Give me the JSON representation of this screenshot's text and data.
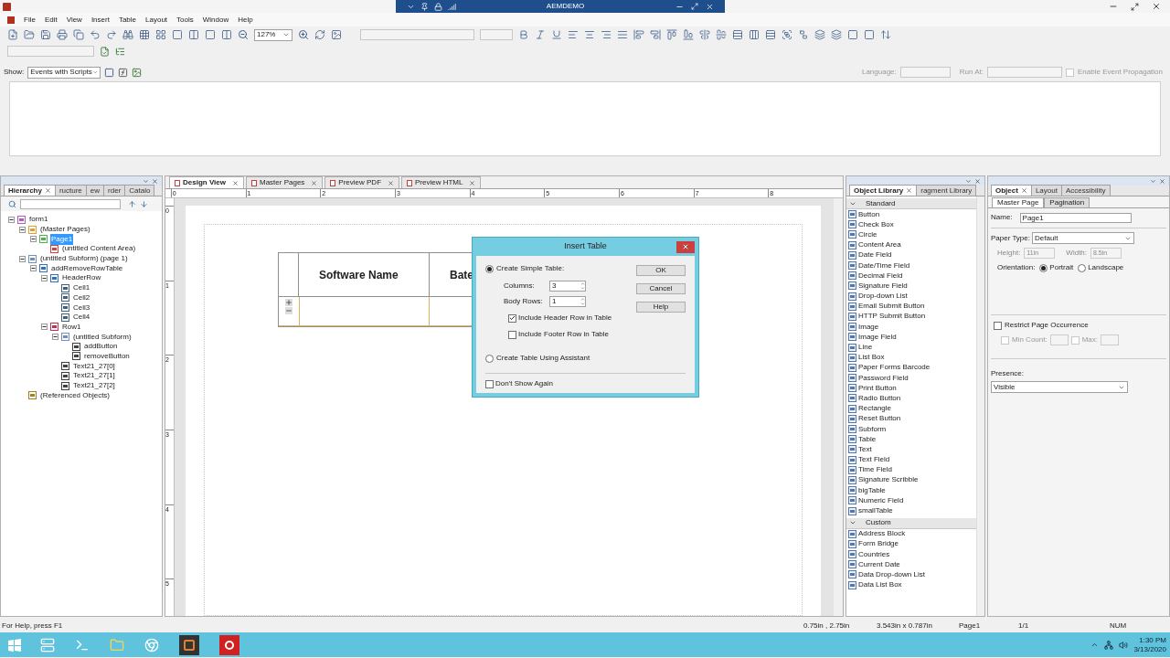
{
  "window": {
    "title": "AEMDEMO"
  },
  "menu": [
    "File",
    "Edit",
    "View",
    "Insert",
    "Table",
    "Layout",
    "Tools",
    "Window",
    "Help"
  ],
  "toolbar": {
    "zoom": "127%"
  },
  "script_bar": {
    "show_label": "Show:",
    "show_value": "Events with Scripts",
    "language_label": "Language:",
    "run_at_label": "Run At:",
    "propagation": {
      "label": "Enable Event Propagation",
      "checked": false
    }
  },
  "hierarchy": {
    "tabs": [
      {
        "label": "Hierarchy",
        "selected": true
      },
      {
        "label": "ructure",
        "selected": false
      },
      {
        "label": "ew",
        "selected": false
      },
      {
        "label": "rder",
        "selected": false
      },
      {
        "label": "Catalo",
        "selected": false
      }
    ],
    "tree": [
      {
        "label": "form1",
        "kind": "form",
        "selected": false,
        "expanded": true,
        "children": [
          {
            "label": "(Master Pages)",
            "kind": "pages",
            "selected": false,
            "expanded": true,
            "children": [
              {
                "label": "Page1",
                "kind": "page",
                "selected": true,
                "expanded": true,
                "children": [
                  {
                    "label": "(untitled Content Area)",
                    "kind": "area",
                    "selected": false
                  }
                ]
              }
            ]
          },
          {
            "label": "(untitled Subform) (page 1)",
            "kind": "subform",
            "selected": false,
            "expanded": true,
            "children": [
              {
                "label": "addRemoveRowTable",
                "kind": "table",
                "selected": false,
                "expanded": true,
                "children": [
                  {
                    "label": "HeaderRow",
                    "kind": "table",
                    "selected": false,
                    "expanded": true,
                    "children": [
                      {
                        "label": "Cell1",
                        "kind": "text",
                        "selected": false
                      },
                      {
                        "label": "Cell2",
                        "kind": "text",
                        "selected": false
                      },
                      {
                        "label": "Cell3",
                        "kind": "text",
                        "selected": false
                      },
                      {
                        "label": "Cell4",
                        "kind": "text",
                        "selected": false
                      }
                    ]
                  },
                  {
                    "label": "Row1",
                    "kind": "row",
                    "selected": false,
                    "expanded": true,
                    "children": [
                      {
                        "label": "(untitled Subform)",
                        "kind": "subform",
                        "selected": false,
                        "expanded": true,
                        "children": [
                          {
                            "label": "addButton",
                            "kind": "button",
                            "selected": false
                          },
                          {
                            "label": "removeButton",
                            "kind": "button",
                            "selected": false
                          }
                        ]
                      },
                      {
                        "label": "Text21_27[0]",
                        "kind": "field",
                        "selected": false
                      },
                      {
                        "label": "Text21_27[1]",
                        "kind": "field",
                        "selected": false
                      },
                      {
                        "label": "Text21_27[2]",
                        "kind": "field",
                        "selected": false
                      }
                    ]
                  }
                ]
              }
            ]
          },
          {
            "label": "(Referenced Objects)",
            "kind": "refs",
            "selected": false
          }
        ]
      }
    ]
  },
  "design": {
    "tabs": [
      {
        "label": "Design View",
        "selected": true
      },
      {
        "label": "Master Pages",
        "selected": false
      },
      {
        "label": "Preview PDF",
        "selected": false
      },
      {
        "label": "Preview HTML",
        "selected": false
      }
    ],
    "ruler": [
      "0",
      "1",
      "2",
      "3",
      "4",
      "5",
      "6",
      "7",
      "8"
    ],
    "vruler": [
      "0",
      "1",
      "2",
      "3",
      "4",
      "5"
    ],
    "table_headers": [
      "Software Name",
      "Bate"
    ]
  },
  "dialog": {
    "title": "Insert Table",
    "simple": {
      "label": "Create Simple Table:",
      "selected": true
    },
    "columns": {
      "label": "Columns:",
      "value": "3"
    },
    "body_rows": {
      "label": "Body Rows:",
      "value": "1"
    },
    "header_row": {
      "label": "Include Header Row in Table",
      "checked": true
    },
    "footer_row": {
      "label": "Include Footer Row in Table",
      "checked": false
    },
    "assistant": {
      "label": "Create Table Using Assistant",
      "selected": false
    },
    "dont_show": {
      "label": "Don't Show Again",
      "checked": false
    },
    "buttons": [
      "OK",
      "Cancel",
      "Help"
    ]
  },
  "object_library": {
    "tabs": [
      {
        "label": "Object Library",
        "selected": true
      },
      {
        "label": "ragment Library",
        "selected": false
      }
    ],
    "groups": [
      {
        "title": "Standard",
        "expanded": true,
        "items": [
          "Button",
          "Check Box",
          "Circle",
          "Content Area",
          "Date Field",
          "Date/Time Field",
          "Decimal Field",
          "Signature Field",
          "Drop-down List",
          "Email Submit Button",
          "HTTP Submit Button",
          "Image",
          "Image Field",
          "Line",
          "List Box",
          "Paper Forms Barcode",
          "Password Field",
          "Print Button",
          "Radio Button",
          "Rectangle",
          "Reset Button",
          "Subform",
          "Table",
          "Text",
          "Text Field",
          "Time Field",
          "Signature Scribble",
          "bigTable",
          "Numeric Field",
          "smallTable"
        ]
      },
      {
        "title": "Custom",
        "expanded": true,
        "items": [
          "Address Block",
          "Form Bridge",
          "Countries",
          "Current Date",
          "Data Drop-down List",
          "Data List Box"
        ]
      }
    ]
  },
  "object": {
    "tabs": [
      {
        "label": "Object",
        "selected": true
      },
      {
        "label": "Layout",
        "selected": false
      },
      {
        "label": "Accessibility",
        "selected": false
      }
    ],
    "subtabs": [
      {
        "label": "Master Page",
        "selected": true
      },
      {
        "label": "Pagination",
        "selected": false
      }
    ],
    "name": {
      "label": "Name:",
      "value": "Page1"
    },
    "paper_type": {
      "label": "Paper Type:",
      "value": "Default"
    },
    "height": {
      "label": "Height:",
      "value": "11in"
    },
    "width": {
      "label": "Width:",
      "value": "8.5in"
    },
    "orientation": {
      "label": "Orientation:",
      "options": [
        {
          "label": "Portrait",
          "selected": true
        },
        {
          "label": "Landscape",
          "selected": false
        }
      ]
    },
    "restrict": {
      "label": "Restrict Page Occurrence",
      "checked": false
    },
    "min_count": {
      "label": "Min Count:",
      "checked": false
    },
    "max": {
      "label": "Max:",
      "checked": false
    },
    "presence": {
      "label": "Presence:",
      "value": "Visible"
    }
  },
  "status_bar": {
    "help": "For Help, press F1",
    "position": "0.75in , 2.75in",
    "size": "3.543in x 0.787in",
    "page": "Page1",
    "pages": "1/1",
    "num": "NUM"
  },
  "taskbar": {
    "time": "1:30 PM",
    "date": "3/13/2020"
  }
}
